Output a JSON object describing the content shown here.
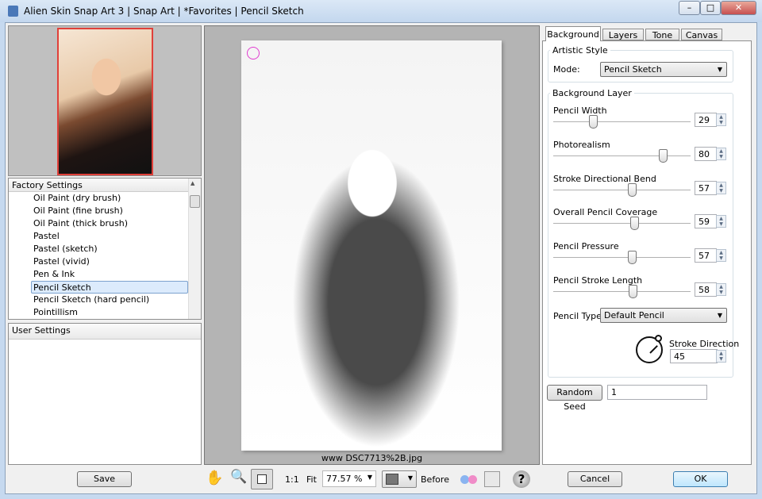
{
  "window": {
    "title": "Alien Skin Snap Art 3 | Snap Art | *Favorites | Pencil Sketch"
  },
  "left": {
    "factory_header": "Factory Settings",
    "factory_items": [
      "Oil Paint (dry brush)",
      "Oil Paint (fine brush)",
      "Oil Paint (thick brush)",
      "Pastel",
      "Pastel (sketch)",
      "Pastel (vivid)",
      "Pen & Ink",
      "Pencil Sketch",
      "Pencil Sketch (hard pencil)",
      "Pointillism"
    ],
    "selected": "Pencil Sketch",
    "user_header": "User Settings",
    "save_label": "Save"
  },
  "canvas": {
    "filename": "www DSC7713%2B.jpg"
  },
  "toolbar": {
    "one_to_one": "1:1",
    "fit": "Fit",
    "zoom": "77.57 %",
    "before": "Before",
    "help": "?"
  },
  "right": {
    "tabs": [
      "Background",
      "Layers",
      "Tone",
      "Canvas"
    ],
    "active_tab": "Background",
    "artistic_style": "Artistic Style",
    "mode_label": "Mode:",
    "mode_value": "Pencil Sketch",
    "background_layer": "Background Layer",
    "sliders": [
      {
        "label": "Pencil Width",
        "value": 29
      },
      {
        "label": "Photorealism",
        "value": 80
      },
      {
        "label": "Stroke Directional Bend",
        "value": 57
      },
      {
        "label": "Overall Pencil Coverage",
        "value": 59
      },
      {
        "label": "Pencil Pressure",
        "value": 57
      },
      {
        "label": "Pencil Stroke Length",
        "value": 58
      }
    ],
    "pencil_type_label": "Pencil Type",
    "pencil_type_value": "Default Pencil",
    "stroke_direction_label": "Stroke Direction",
    "stroke_direction_value": "45",
    "random_seed_label": "Random Seed",
    "random_seed_value": "1"
  },
  "buttons": {
    "cancel": "Cancel",
    "ok": "OK"
  }
}
